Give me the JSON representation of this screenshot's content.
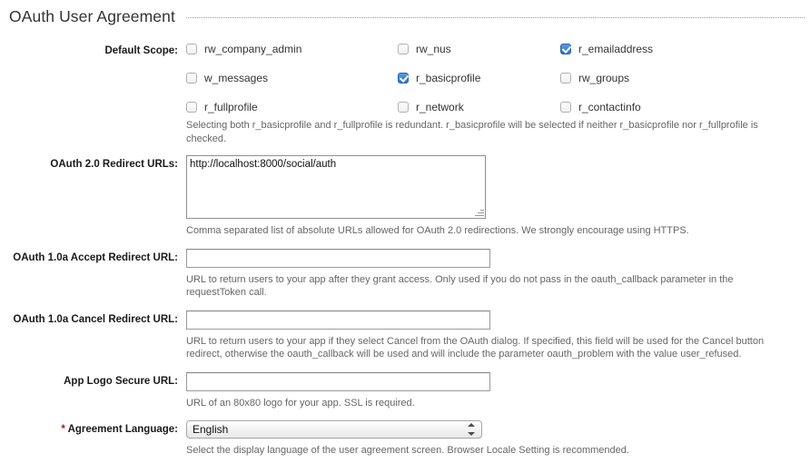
{
  "section": {
    "title": "OAuth User Agreement"
  },
  "fields": {
    "default_scope": {
      "label": "Default Scope:",
      "options": [
        {
          "label": "rw_company_admin",
          "checked": false
        },
        {
          "label": "rw_nus",
          "checked": false
        },
        {
          "label": "r_emailaddress",
          "checked": true
        },
        {
          "label": "w_messages",
          "checked": false
        },
        {
          "label": "r_basicprofile",
          "checked": true
        },
        {
          "label": "rw_groups",
          "checked": false
        },
        {
          "label": "r_fullprofile",
          "checked": false
        },
        {
          "label": "r_network",
          "checked": false
        },
        {
          "label": "r_contactinfo",
          "checked": false
        }
      ],
      "help": "Selecting both r_basicprofile and r_fullprofile is redundant. r_basicprofile will be selected if neither r_basicprofile nor r_fullprofile is checked."
    },
    "redirect_urls": {
      "label": "OAuth 2.0 Redirect URLs:",
      "value": "http://localhost:8000/social/auth",
      "placeholder": "",
      "help": "Comma separated list of absolute URLs allowed for OAuth 2.0 redirections. We strongly encourage using HTTPS."
    },
    "accept_redirect": {
      "label": "OAuth 1.0a Accept Redirect URL:",
      "value": "",
      "placeholder": "",
      "help": "URL to return users to your app after they grant access. Only used if you do not pass in the oauth_callback parameter in the requestToken call."
    },
    "cancel_redirect": {
      "label": "OAuth 1.0a Cancel Redirect URL:",
      "value": "",
      "placeholder": "",
      "help": "URL to return users to your app if they select Cancel from the OAuth dialog. If specified, this field will be used for the Cancel button redirect, otherwise the oauth_callback will be used and will include the parameter oauth_problem with the value user_refused."
    },
    "app_logo_url": {
      "label": "App Logo Secure URL:",
      "value": "",
      "placeholder": "",
      "help": "URL of an 80x80 logo for your app. SSL is required."
    },
    "agreement_language": {
      "required_marker": "*",
      "label": "Agreement Language:",
      "selected": "English",
      "options": [
        "English"
      ],
      "help": "Select the display language of the user agreement screen. Browser Locale Setting is recommended."
    }
  },
  "colors": {
    "title": "#333333",
    "label": "#1a1a1a",
    "help": "#666666",
    "required_star": "#a01c1c",
    "checkbox_checked": "#2f72c8",
    "rule": "#999999"
  }
}
